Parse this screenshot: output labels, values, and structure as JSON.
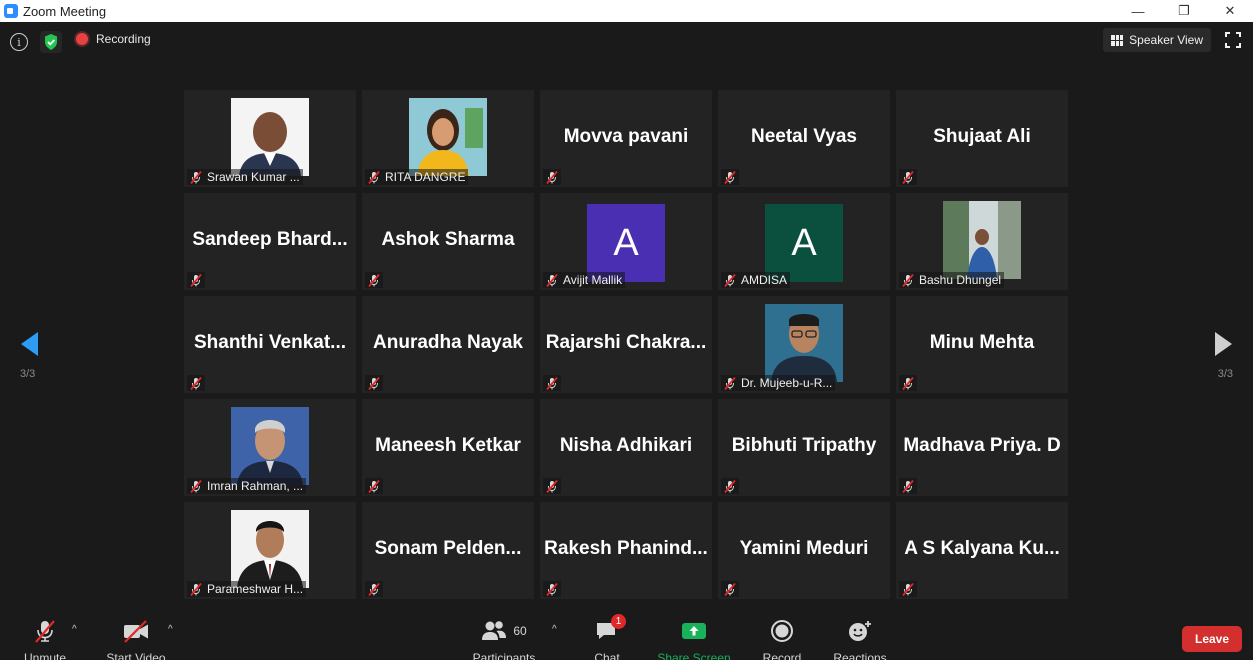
{
  "window": {
    "title": "Zoom Meeting",
    "minimize": "—",
    "restore": "❐",
    "close": "✕"
  },
  "topbar": {
    "info_glyph": "i",
    "recording_label": "Recording",
    "speaker_view_label": "Speaker View"
  },
  "navigation": {
    "page_left": "3/3",
    "page_right": "3/3"
  },
  "participants": [
    {
      "name": "Srawan Kumar ...",
      "mode": "photo",
      "photo": "man-bald"
    },
    {
      "name": "RITA DANGRE",
      "mode": "photo",
      "photo": "woman"
    },
    {
      "name": "Movva pavani",
      "mode": "name"
    },
    {
      "name": "Neetal Vyas",
      "mode": "name"
    },
    {
      "name": "Shujaat Ali",
      "mode": "name"
    },
    {
      "name": "Sandeep  Bhard...",
      "mode": "name"
    },
    {
      "name": "Ashok Sharma",
      "mode": "name"
    },
    {
      "name": "Avijit Mallik",
      "mode": "avatar",
      "initial": "A",
      "color": "#4b2fb3"
    },
    {
      "name": "AMDISA",
      "mode": "avatar",
      "initial": "A",
      "color": "#0b4f3e"
    },
    {
      "name": "Bashu Dhungel",
      "mode": "photo",
      "photo": "outdoor"
    },
    {
      "name": "Shanthi  Venkat...",
      "mode": "name"
    },
    {
      "name": "Anuradha Nayak",
      "mode": "name"
    },
    {
      "name": "Rajarshi  Chakra...",
      "mode": "name"
    },
    {
      "name": "Dr. Mujeeb-u-R...",
      "mode": "photo",
      "photo": "man-glasses"
    },
    {
      "name": "Minu Mehta",
      "mode": "name"
    },
    {
      "name": "Imran Rahman, ...",
      "mode": "photo",
      "photo": "man-grey"
    },
    {
      "name": "Maneesh Ketkar",
      "mode": "name"
    },
    {
      "name": "Nisha Adhikari",
      "mode": "name"
    },
    {
      "name": "Bibhuti Tripathy",
      "mode": "name"
    },
    {
      "name": "Madhava Priya. D",
      "mode": "name"
    },
    {
      "name": "Parameshwar H...",
      "mode": "photo",
      "photo": "man-suit"
    },
    {
      "name": "Sonam  Pelden...",
      "mode": "name"
    },
    {
      "name": "Rakesh  Phanind...",
      "mode": "name"
    },
    {
      "name": "Yamini Meduri",
      "mode": "name"
    },
    {
      "name": "A S Kalyana Ku...",
      "mode": "name"
    }
  ],
  "toolbar": {
    "unmute_label": "Unmute",
    "start_video_label": "Start Video",
    "participants_label": "Participants",
    "participants_count": "60",
    "chat_label": "Chat",
    "chat_badge": "1",
    "share_label": "Share Screen",
    "record_label": "Record",
    "reactions_label": "Reactions",
    "leave_label": "Leave",
    "caret": "^"
  },
  "colors": {
    "share_green": "#19b15b",
    "leave_red": "#d32f2f",
    "record_red": "#e84141"
  }
}
